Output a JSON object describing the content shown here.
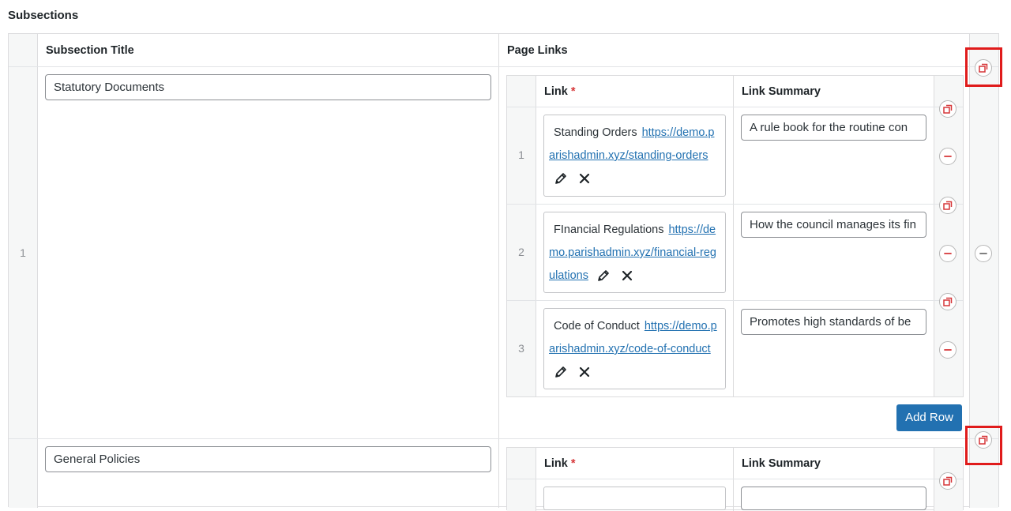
{
  "section": {
    "title": "Subsections"
  },
  "table": {
    "col_title": "Subsection Title",
    "col_links": "Page Links"
  },
  "rows": [
    {
      "number": "1",
      "title_value": "Statutory Documents",
      "links_table": {
        "col_link": "Link",
        "required_mark": "*",
        "col_summary": "Link Summary",
        "rows": [
          {
            "number": "1",
            "link_title": "Standing Orders",
            "link_url": "https://demo.parishadmin.xyz/standing-orders",
            "summary": "A rule book for the routine con"
          },
          {
            "number": "2",
            "link_title": "FInancial Regulations",
            "link_url": "https://demo.parishadmin.xyz/financial-regulations",
            "summary": "How the council manages its fin"
          },
          {
            "number": "3",
            "link_title": "Code of Conduct",
            "link_url": "https://demo.parishadmin.xyz/code-of-conduct",
            "summary": "Promotes high standards of be"
          }
        ],
        "add_row_label": "Add Row"
      }
    },
    {
      "number": "",
      "title_value": "General Policies",
      "links_table": {
        "col_link": "Link",
        "required_mark": "*",
        "col_summary": "Link Summary"
      }
    }
  ],
  "icons": {
    "edit": "pencil-icon",
    "remove_link": "close-icon",
    "duplicate": "duplicate-row-icon",
    "remove_row": "remove-row-icon"
  },
  "colors": {
    "accent": "#2271b1",
    "danger": "#d63638",
    "highlight": "#e01b1b"
  }
}
